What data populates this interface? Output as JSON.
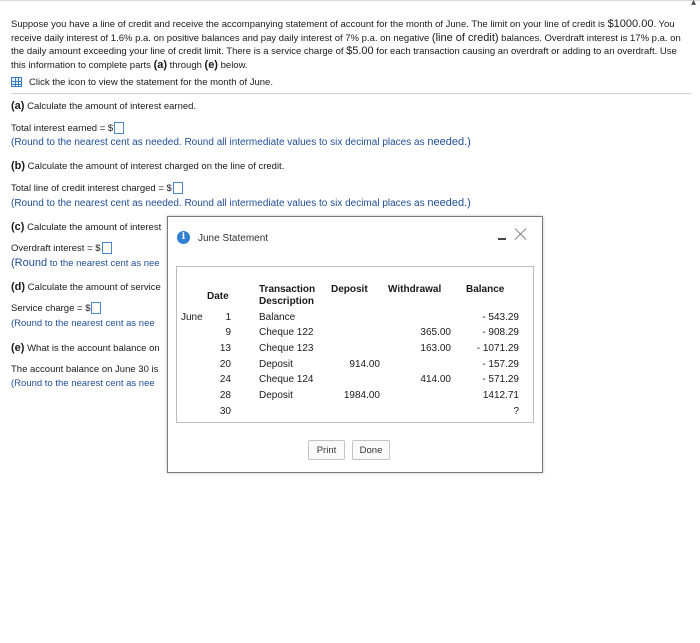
{
  "problem": {
    "intro_1": "Suppose you have a line of credit and receive the accompanying statement of account for the month of June. The limit on your line of credit is ",
    "limit": "$1000.00",
    "intro_2": ". You receive daily interest of 1.6% p.a. on positive balances and pay daily interest of 7% p.a. on negative ",
    "intro_3": "(line of credit)",
    "intro_4": " balances. Overdraft interest is 17% p.a. on the daily amount exceeding your line of credit limit. There is a service charge of ",
    "service_charge": "$5.00",
    "intro_5": " for each transaction causing an overdraft or adding to an overdraft. Use this information to complete parts ",
    "part_a_ref": "(a)",
    "intro_6": " through ",
    "part_e_ref": "(e)",
    "intro_7": " below.",
    "statement_link": "Click the icon to view the statement for the month of June."
  },
  "parts": {
    "a": {
      "label": "(a)",
      "question": " Calculate the amount of interest earned.",
      "answer_label": "Total interest earned = $",
      "hint_1": "(Round to the nearest cent as needed. Round all intermediate values to six decimal places as ",
      "hint_2": "needed.)"
    },
    "b": {
      "label": "(b)",
      "question": " Calculate the amount of interest charged on the line of credit.",
      "answer_label": "Total line of credit interest charged = $",
      "hint_1": "(Round to the nearest cent as needed. Round all intermediate values to six decimal places as ",
      "hint_2": "needed.)"
    },
    "c": {
      "label": "(c)",
      "question": " Calculate the amount of interest",
      "answer_label": "Overdraft interest = $",
      "hint_1": "(Round",
      "hint_2": " to the nearest cent as nee"
    },
    "d": {
      "label": "(d)",
      "question": " Calculate the amount of service",
      "answer_label": "Service charge = $",
      "hint": "(Round to the nearest cent as nee"
    },
    "e": {
      "label": "(e)",
      "question": " What is the account balance on",
      "answer_label": "The account balance on June 30 is",
      "hint": "(Round to the nearest cent as nee"
    }
  },
  "modal": {
    "title": "June Statement",
    "headers": {
      "date": "Date",
      "description_1": "Transaction",
      "description_2": "Description",
      "deposit": "Deposit",
      "withdrawal": "Withdrawal",
      "balance": "Balance"
    },
    "rows": [
      {
        "month": "June",
        "day": "1",
        "description": "Balance",
        "deposit": "",
        "withdrawal": "",
        "balance": "- 543.29"
      },
      {
        "month": "",
        "day": "9",
        "description": "Cheque 122",
        "deposit": "",
        "withdrawal": "365.00",
        "balance": "- 908.29"
      },
      {
        "month": "",
        "day": "13",
        "description": "Cheque 123",
        "deposit": "",
        "withdrawal": "163.00",
        "balance": "- 1071.29"
      },
      {
        "month": "",
        "day": "20",
        "description": "Deposit",
        "deposit": "914.00",
        "withdrawal": "",
        "balance": "- 157.29"
      },
      {
        "month": "",
        "day": "24",
        "description": "Cheque 124",
        "deposit": "",
        "withdrawal": "414.00",
        "balance": "- 571.29"
      },
      {
        "month": "",
        "day": "28",
        "description": "Deposit",
        "deposit": "1984.00",
        "withdrawal": "",
        "balance": "1412.71"
      },
      {
        "month": "",
        "day": "30",
        "description": "",
        "deposit": "",
        "withdrawal": "",
        "balance": "?"
      }
    ],
    "print_label": "Print",
    "done_label": "Done"
  }
}
